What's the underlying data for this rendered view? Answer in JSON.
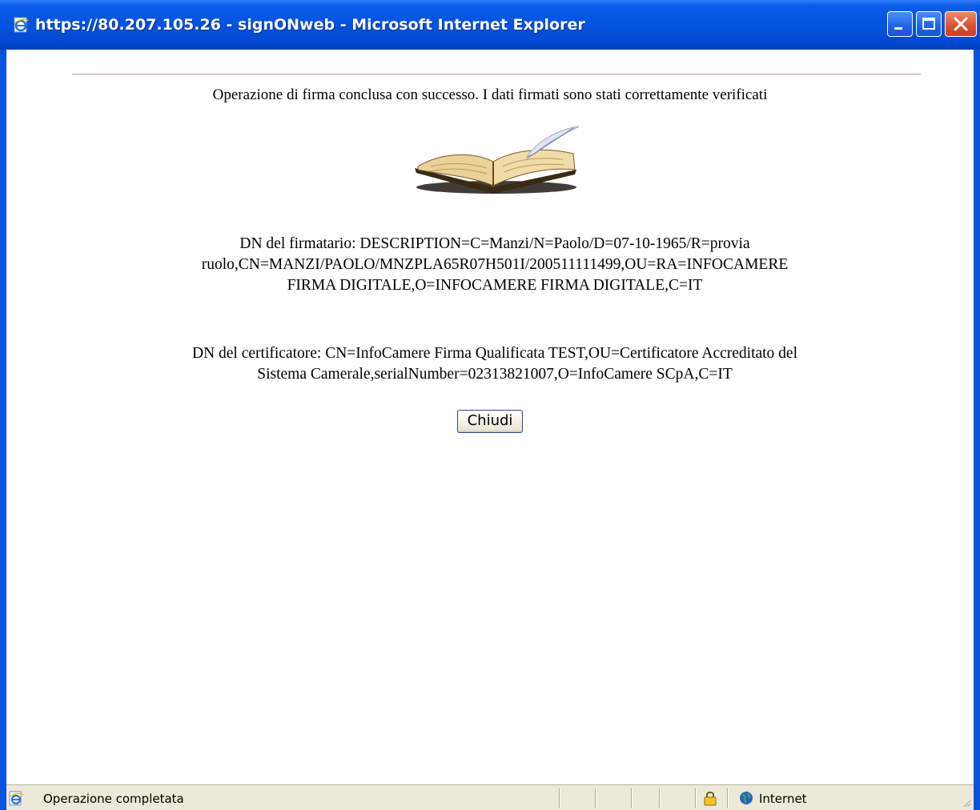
{
  "window": {
    "title": "https://80.207.105.26 - signONweb - Microsoft Internet Explorer"
  },
  "page": {
    "message": "Operazione di firma conclusa con successo. I dati firmati sono stati correttamente verificati",
    "signer_dn": {
      "line1": "DN del firmatario: DESCRIPTION=C=Manzi/N=Paolo/D=07-10-1965/R=provia",
      "line2": "ruolo,CN=MANZI/PAOLO/MNZPLA65R07H501I/200511111499,OU=RA=INFOCAMERE",
      "line3": "FIRMA DIGITALE,O=INFOCAMERE FIRMA DIGITALE,C=IT"
    },
    "certifier_dn": {
      "line1": "DN del certificatore: CN=InfoCamere Firma Qualificata TEST,OU=Certificatore Accreditato del",
      "line2": "Sistema Camerale,serialNumber=02313821007,O=InfoCamere SCpA,C=IT"
    },
    "close_button": "Chiudi"
  },
  "statusbar": {
    "text": "Operazione completata",
    "zone": "Internet"
  },
  "colors": {
    "titlebar": "#0453e0",
    "statusbar": "#ece9d8",
    "close_button": "#d8502d"
  },
  "icons": [
    "ie-page-icon",
    "minimize-icon",
    "maximize-icon",
    "close-icon",
    "book-quill-icon",
    "lock-icon",
    "globe-icon",
    "resize-grip-icon"
  ]
}
